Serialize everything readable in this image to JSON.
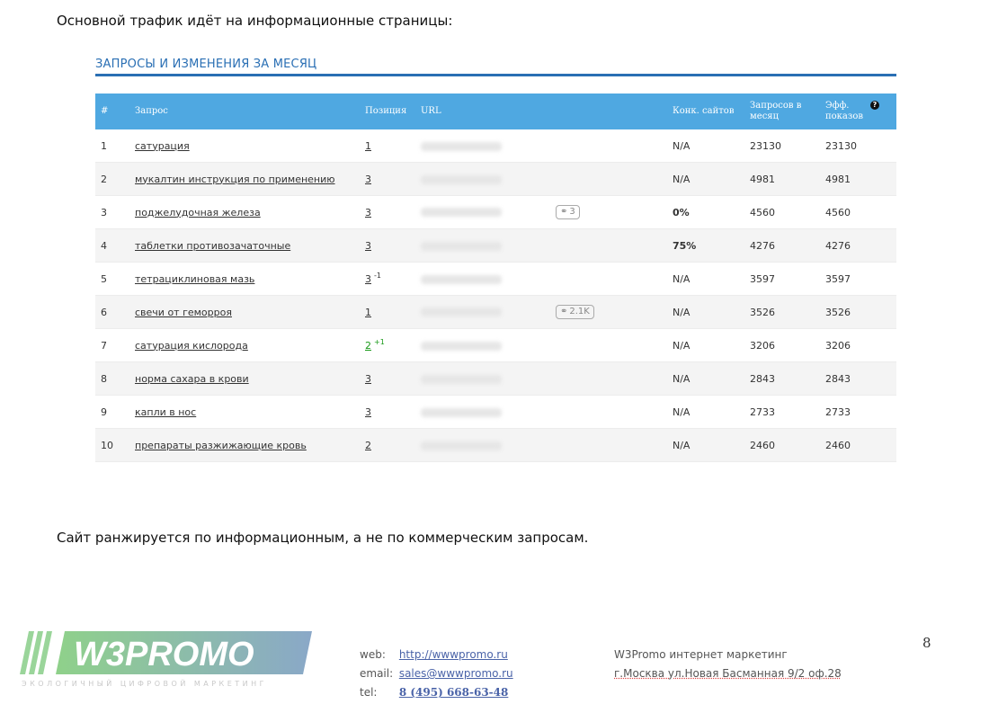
{
  "intro_text": "Основной трафик идёт на информационные страницы:",
  "section_title": "ЗАПРОСЫ И ИЗМЕНЕНИЯ ЗА МЕСЯЦ",
  "table": {
    "headers": {
      "num": "#",
      "query": "Запрос",
      "position": "Позиция",
      "url": "URL",
      "competitors": "Конк. сайтов",
      "requests": "Запросов в месяц",
      "impressions": "Эфф. показов"
    },
    "rows": [
      {
        "num": "1",
        "query": "сатурация",
        "position": "1",
        "delta": "",
        "links": "",
        "competitors": "N/A",
        "requests": "23130",
        "impressions": "23130"
      },
      {
        "num": "2",
        "query": "мукалтин инструкция по применению",
        "position": "3",
        "delta": "",
        "links": "",
        "competitors": "N/A",
        "requests": "4981",
        "impressions": "4981"
      },
      {
        "num": "3",
        "query": "поджелудочная железа",
        "position": "3",
        "delta": "",
        "links": "3",
        "competitors": "0%",
        "requests": "4560",
        "impressions": "4560"
      },
      {
        "num": "4",
        "query": "таблетки противозачаточные",
        "position": "3",
        "delta": "",
        "links": "",
        "competitors": "75%",
        "requests": "4276",
        "impressions": "4276"
      },
      {
        "num": "5",
        "query": "тетрациклиновая мазь",
        "position": "3",
        "delta": "-1",
        "links": "",
        "competitors": "N/A",
        "requests": "3597",
        "impressions": "3597"
      },
      {
        "num": "6",
        "query": "свечи от геморроя",
        "position": "1",
        "delta": "",
        "links": "2.1K",
        "competitors": "N/A",
        "requests": "3526",
        "impressions": "3526"
      },
      {
        "num": "7",
        "query": "сатурация кислорода",
        "position": "2",
        "delta": "+1",
        "links": "",
        "competitors": "N/A",
        "requests": "3206",
        "impressions": "3206"
      },
      {
        "num": "8",
        "query": "норма сахара в крови",
        "position": "3",
        "delta": "",
        "links": "",
        "competitors": "N/A",
        "requests": "2843",
        "impressions": "2843"
      },
      {
        "num": "9",
        "query": "капли в нос",
        "position": "3",
        "delta": "",
        "links": "",
        "competitors": "N/A",
        "requests": "2733",
        "impressions": "2733"
      },
      {
        "num": "10",
        "query": "препараты разжижающие кровь",
        "position": "2",
        "delta": "",
        "links": "",
        "competitors": "N/A",
        "requests": "2460",
        "impressions": "2460"
      }
    ]
  },
  "conclusion_text": "Сайт ранжируется по информационным, а не по коммерческим запросам.",
  "footer": {
    "logo_text": "W3PROMO",
    "logo_tagline": "ЭКОЛОГИЧНЫЙ ЦИФРОВОЙ МАРКЕТИНГ",
    "web_label": "web:",
    "web_value": "http://wwwpromo.ru",
    "email_label": "email:",
    "email_value": "sales@wwwpromo.ru",
    "tel_label": "tel:",
    "tel_value": "8 (495) 668-63-48",
    "company_name": "W3Promo интернет маркетинг",
    "company_address": "г.Москва ул.Новая Басманная 9/2 оф.28",
    "page_number": "8"
  },
  "colors": {
    "accent": "#2a6fb4",
    "header_bg": "#4fa8e1",
    "positive": "#1a9a1a"
  }
}
